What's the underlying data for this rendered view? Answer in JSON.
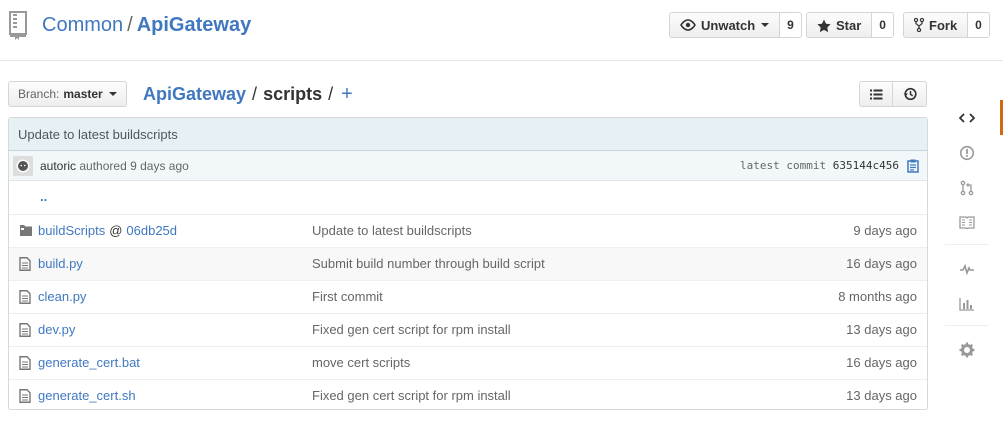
{
  "repo": {
    "owner": "Common",
    "separator": "/",
    "name": "ApiGateway",
    "actions": {
      "watch": {
        "label": "Unwatch",
        "count": "9"
      },
      "star": {
        "label": "Star",
        "count": "0"
      },
      "fork": {
        "label": "Fork",
        "count": "0"
      }
    }
  },
  "branch": {
    "label": "Branch:",
    "value": "master"
  },
  "breadcrumb": {
    "root": "ApiGateway",
    "sep1": "/",
    "current": "scripts",
    "sep2": "/",
    "plus": "+"
  },
  "commit": {
    "message": "Update to latest buildscripts",
    "author": "autoric",
    "authored_text": "authored 9 days ago",
    "latest_label": "latest commit",
    "sha": "635144c456"
  },
  "files": {
    "up_label": "..",
    "rows": [
      {
        "name": "buildScripts",
        "at": "@",
        "ref": "06db25d",
        "message": "Update to latest buildscripts",
        "age": "9 days ago"
      },
      {
        "name": "build.py",
        "message": "Submit build number through build script",
        "age": "16 days ago"
      },
      {
        "name": "clean.py",
        "message": "First commit",
        "age": "8 months ago"
      },
      {
        "name": "dev.py",
        "message": "Fixed gen cert script for rpm install",
        "age": "13 days ago"
      },
      {
        "name": "generate_cert.bat",
        "message": "move cert scripts",
        "age": "16 days ago"
      },
      {
        "name": "generate_cert.sh",
        "message": "Fixed gen cert script for rpm install",
        "age": "13 days ago"
      }
    ]
  },
  "sidebar": {
    "icons": [
      "code-icon",
      "issues-icon",
      "pull-requests-icon",
      "wiki-icon",
      "pulse-icon",
      "graphs-icon",
      "settings-icon"
    ]
  },
  "colors": {
    "link": "#4078c0",
    "accent": "#d26911",
    "commit_bg": "#e6f1f6"
  }
}
